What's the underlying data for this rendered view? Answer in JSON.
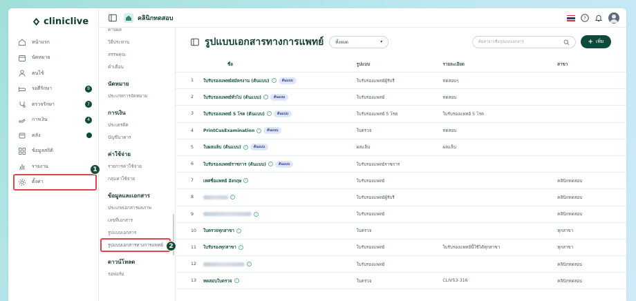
{
  "app": {
    "logo_text": "cliniclive",
    "clinic_name": "คลินิกทดสอบ",
    "brand_color": "#0d4a3c",
    "highlight_color": "#e0434a"
  },
  "sidebar": {
    "items": [
      {
        "label": "หน้าแรก",
        "icon": "home-icon"
      },
      {
        "label": "นัดหมาย",
        "icon": "calendar-icon"
      },
      {
        "label": "คนไข้",
        "icon": "user-icon"
      },
      {
        "label": "รอตีรักษา",
        "icon": "bed-icon",
        "badge": "9"
      },
      {
        "label": "ตรวจรักษา",
        "icon": "stethoscope-icon",
        "badge": "7"
      },
      {
        "label": "การเงิน",
        "icon": "cash-icon",
        "badge": "4"
      },
      {
        "label": "คลัง",
        "icon": "box-icon",
        "dot": true
      },
      {
        "label": "ข้อมูลสถิติ",
        "icon": "grid-icon"
      },
      {
        "label": "รายงาน",
        "icon": "chart-icon"
      },
      {
        "label": "ตั้งค่า",
        "icon": "gear-icon",
        "active": true
      }
    ]
  },
  "callouts": {
    "one": "1",
    "two": "2"
  },
  "submenu": {
    "groups": [
      {
        "title": "",
        "items": [
          "คาบผล",
          "วิธีประทาน",
          "สรรพคุณ",
          "คำเตือน"
        ]
      },
      {
        "title": "นัดหมาย",
        "items": [
          "ประเภทการจัดหมาย"
        ]
      },
      {
        "title": "การเงิน",
        "items": [
          "ประเครดิต",
          "บัญชีนาคาร"
        ]
      },
      {
        "title": "ค่าใช้จ่าย",
        "items": [
          "รายการค่าใช้จ่าย",
          "กลุ่มค่าใช้จ่าย"
        ]
      },
      {
        "title": "ข้อมูลและเอกสาร",
        "items": [
          "ประเภทเอกสารผลภาพ",
          "เลขที่เอกสาร",
          "รูปแบบเอกสาร",
          "รูปแบบเอกสารทางการแพทย์"
        ]
      },
      {
        "title": "ดาวน์โหลด",
        "items": [
          "รอฟอร์ม"
        ]
      }
    ],
    "active_item": "รูปแบบเอกสารทางการแพทย์"
  },
  "page": {
    "title": "รูปแบบเอกสารทางการแพทย์",
    "filter_value": "ทั้งหมด",
    "search_placeholder": "ค้นหาจากชื่อรูปแบบเอกสาร",
    "add_label": "เพิ่ม"
  },
  "table": {
    "headers": {
      "no": "",
      "name": "ชื่อ",
      "type": "รูปแบบ",
      "detail": "รายละเอียด",
      "branch": "สาขา"
    },
    "rows": [
      {
        "no": "1",
        "name": "ใบรับรองแพทย์สมัครงาน (ต้นแบบ)",
        "tag": "ต้นแบบ",
        "type": "ใบรับรองแพทย์ผู้รับรี",
        "detail": "ทดสอบๆ",
        "branch": ""
      },
      {
        "no": "2",
        "name": "ใบรับรองแพทย์ทั่วไป (ต้นแบบ)",
        "tag": "ต้นแบบ",
        "type": "ใบรับรองแพทย์",
        "detail": "ทดสอบ",
        "branch": ""
      },
      {
        "no": "3",
        "name": "ใบรับรองแพทย์ 5 โรค (ต้นแบบ)",
        "tag": "ต้นแบบ",
        "type": "ใบรับรองแพทย์ 5 โรค",
        "detail": "ใบรับรองแพทย์ 5 โรค",
        "branch": ""
      },
      {
        "no": "4",
        "name": "PrintCusExamination",
        "tag": "ต้นแบบ",
        "type": "ใบตรวจ",
        "detail": "ทดสอบ",
        "branch": ""
      },
      {
        "no": "5",
        "name": "ใบผลแล็บ (ต้นแบบ)",
        "tag": "ต้นแบบ",
        "type": "ผลแล็บ",
        "detail": "ผลแล็บ",
        "branch": ""
      },
      {
        "no": "6",
        "name": "ใบรับรองแพทย์ราชการ (ต้นแบบ)",
        "tag": "ต้นแบบ",
        "type": "ใบรับรองแพทย์ราชการ",
        "detail": "",
        "branch": ""
      },
      {
        "no": "7",
        "name": "เทศชื่อแพทย์ อังกฤษ",
        "tag": "",
        "type": "ใบรับรองแพทย์",
        "detail": "",
        "branch": "คลินิกทดสอบ"
      },
      {
        "no": "8",
        "name": "",
        "blur": 36,
        "tag": "",
        "type": "ใบรับรองแพทย์ผู้รับรี",
        "detail": "",
        "branch": "คลินิกทดสอบ"
      },
      {
        "no": "9",
        "name": "",
        "blur": 70,
        "tag": "",
        "type": "ใบรับรองแพทย์",
        "detail": "",
        "branch": "คลินิกทดสอบ"
      },
      {
        "no": "10",
        "name": "ใบตรวจทุกสาขา",
        "tag": "",
        "type": "ใบตรวจ",
        "detail": "",
        "branch": "ทุกสาขา"
      },
      {
        "no": "11",
        "name": "ใบรับรองทุกสาขา",
        "tag": "",
        "type": "ใบรับรองแพทย์",
        "detail": "ใบรับรองแพทย์นี้ใช้ได้ทุกสาขา",
        "branch": "ทุกสาขา"
      },
      {
        "no": "12",
        "name": "",
        "blur": 60,
        "tag": "",
        "type": "ใบรับรองแพทย์",
        "detail": "",
        "branch": "คลินิกทดสอบ"
      },
      {
        "no": "13",
        "name": "ทดสอบใบตรวจ",
        "tag": "",
        "type": "ใบตรวจ",
        "detail": "CLIV53-316",
        "branch": "คลินิกทดสอบ"
      }
    ]
  }
}
